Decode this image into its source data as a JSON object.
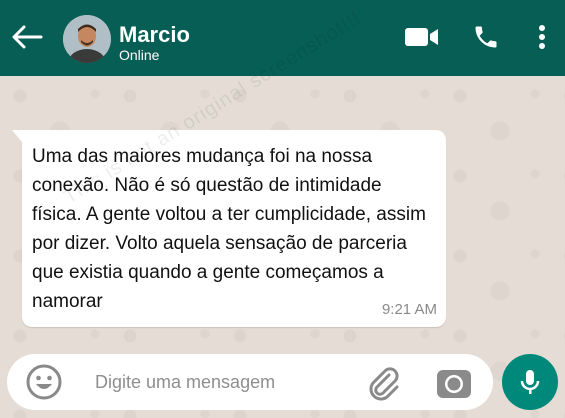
{
  "header": {
    "contact_name": "Marcio",
    "status": "Online",
    "icons": {
      "back": "arrow-left-icon",
      "video": "video-camera-icon",
      "call": "phone-icon",
      "menu": "more-vertical-icon"
    },
    "color": "#075e54"
  },
  "chat": {
    "watermark": "This is not an original screenshot!!!",
    "messages": [
      {
        "text": "Uma das maiores mudança foi na nossa conexão. Não é só questão de intimidade física. A gente voltou a ter cumplicidade, assim por dizer. Volto aquela sensação de parceria que existia quando a gente começamos a namorar",
        "time": "9:21 AM",
        "direction": "incoming"
      }
    ],
    "background_color": "#e5ddd5"
  },
  "composer": {
    "placeholder": "Digite uma mensagem",
    "value": "",
    "icons": {
      "emoji": "emoji-icon",
      "attach": "paperclip-icon",
      "camera": "camera-icon",
      "mic": "microphone-icon"
    },
    "mic_color": "#00897b"
  }
}
